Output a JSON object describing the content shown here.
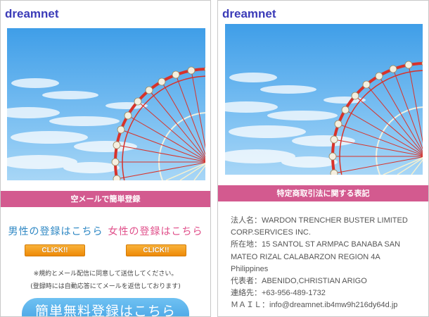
{
  "left": {
    "brand": "dreamnet",
    "band_title": "空メールで簡単登録",
    "male_label": "男性の登録はこちら",
    "female_label": "女性の登録はこちら",
    "click_label": "CLICK!!",
    "note_line1": "※規約とメール配信に同意して送信してください。",
    "note_line2": "(登録時には自動応答にてメールを返信しております)",
    "big_button": "簡単無料登録はこちら"
  },
  "right": {
    "brand": "dreamnet",
    "band_title": "特定商取引法に関する表記",
    "info": [
      "法人名：WARDON TRENCHER BUSTER LIMITED",
      "CORP.SERVICES INC.",
      "所在地：15 SANTOL ST ARMPAC BANABA SAN",
      "MATEO RIZAL CALABARZON REGION 4A",
      "Philippines",
      "代表者：ABENIDO,CHRISTIAN ARIGO",
      "連絡先：+63-956-489-1732",
      "ＭＡＩＬ：info@dreamnet.ib4mw9h216dy64d.jp"
    ]
  },
  "colors": {
    "brand": "#3b3bb8",
    "band": "#d35a8f",
    "male": "#2f88c4",
    "female": "#e04f8a",
    "click": "#f39a1c",
    "big_button": "#4aa8ea"
  },
  "images": {
    "hero": "ferris-wheel-sky-photo"
  }
}
